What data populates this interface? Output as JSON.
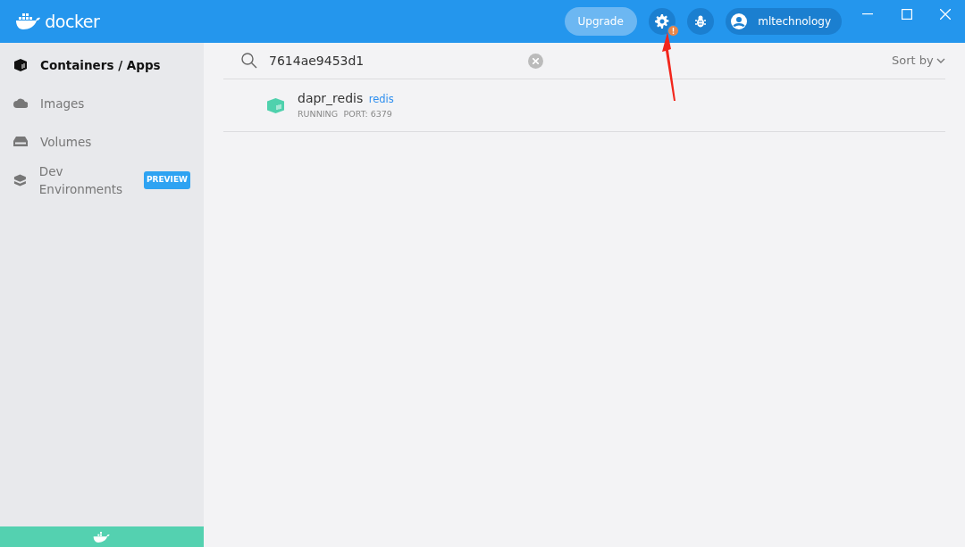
{
  "header": {
    "logo_text": "docker",
    "upgrade": "Upgrade",
    "settings_alert": true,
    "user": "mltechnology"
  },
  "sidebar": {
    "items": [
      {
        "label": "Containers / Apps",
        "selected": true
      },
      {
        "label": "Images",
        "selected": false
      },
      {
        "label": "Volumes",
        "selected": false
      },
      {
        "label": "Dev Environments",
        "selected": false,
        "badge": "PREVIEW"
      }
    ]
  },
  "search": {
    "value": "7614ae9453d1"
  },
  "sort": {
    "label": "Sort by"
  },
  "containers": [
    {
      "name": "dapr_redis",
      "image": "redis",
      "status": "RUNNING",
      "port": "PORT: 6379"
    }
  ]
}
